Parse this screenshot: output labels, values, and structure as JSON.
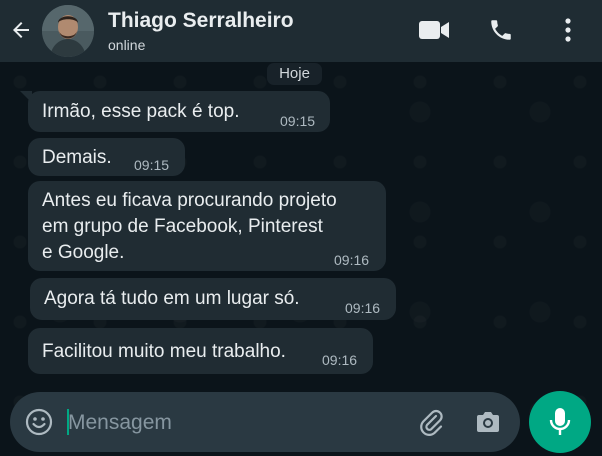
{
  "header": {
    "contact_name": "Thiago Serralheiro",
    "status": "online",
    "icons": [
      "back-arrow-icon",
      "video-call-icon",
      "phone-icon",
      "more-options-icon"
    ]
  },
  "day_divider": "Hoje",
  "messages": [
    {
      "text": "Irmão, esse pack é top.",
      "time": "09:15"
    },
    {
      "text": "Demais.",
      "time": "09:15"
    },
    {
      "lines": [
        "Antes eu ficava procurando projeto",
        "em grupo de Facebook, Pinterest",
        "e Google."
      ],
      "time": "09:16"
    },
    {
      "text": "Agora tá tudo em um lugar só.",
      "time": "09:16"
    },
    {
      "text": "Facilitou muito meu trabalho.",
      "time": "09:16"
    }
  ],
  "composer": {
    "placeholder": "Mensagem",
    "value": ""
  },
  "colors": {
    "header_bg": "#1f2c33",
    "chat_bg": "#0b141a",
    "bubble_bg": "#202c33",
    "input_bg": "#2a3942",
    "accent": "#00a884"
  }
}
